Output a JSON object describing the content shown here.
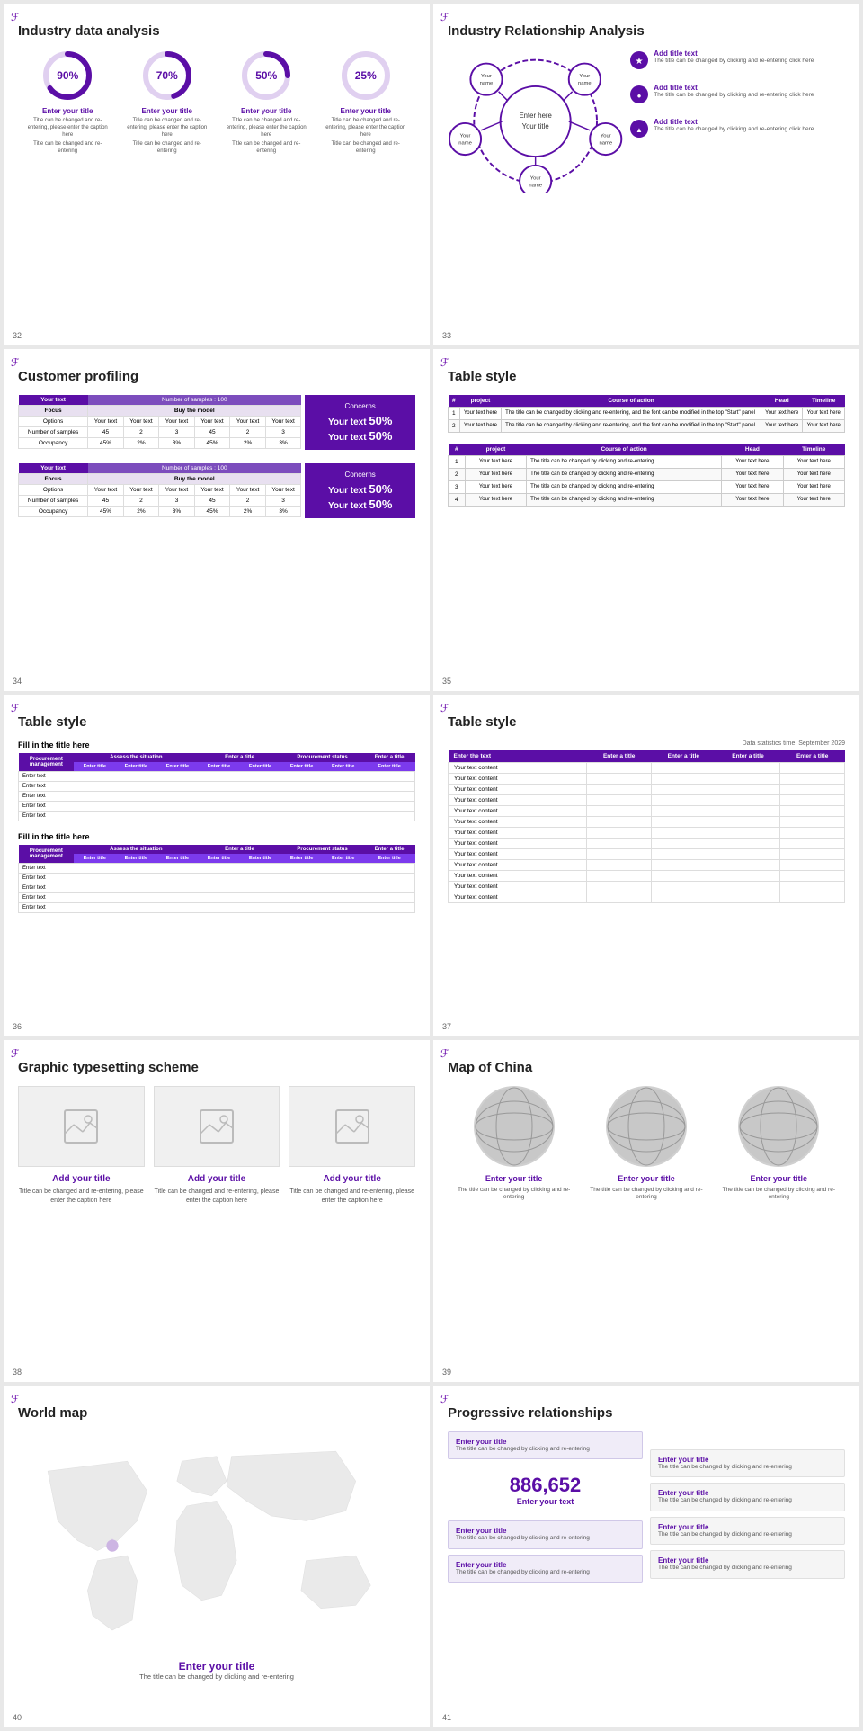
{
  "slides": {
    "s32": {
      "number": "32",
      "title": "Industry data analysis",
      "circles": [
        {
          "pct": "90%",
          "label": "Enter your title",
          "desc1": "Title can be changed and re-entering, please enter the caption here",
          "desc2": "Title can be changed and re-entering",
          "color": "#5b0ea6"
        },
        {
          "pct": "70%",
          "label": "Enter your title",
          "desc1": "Title can be changed and re-entering, please enter the caption here",
          "desc2": "Title can be changed and re-entering",
          "color": "#5b0ea6"
        },
        {
          "pct": "50%",
          "label": "Enter your title",
          "desc1": "Title can be changed and re-entering, please enter the caption here",
          "desc2": "Title can be changed and re-entering",
          "color": "#5b0ea6"
        },
        {
          "pct": "25%",
          "label": "Enter your title",
          "desc1": "Title can be changed and re-entering, please enter the caption here",
          "desc2": "Title can be changed and re-entering",
          "color": "#5b0ea6"
        }
      ]
    },
    "s33": {
      "number": "33",
      "title": "Industry Relationship Analysis",
      "hub": {
        "center_line1": "Enter here",
        "center_line2": "Your title",
        "nodes": [
          "Your name",
          "Your name",
          "Your name",
          "Your name",
          "Your name"
        ]
      },
      "right_items": [
        {
          "title": "Add title text",
          "desc": "The title can be changed by clicking and re-entering click here"
        },
        {
          "title": "Add title text",
          "desc": "The title can be changed by clicking and re-entering click here"
        },
        {
          "title": "Add title text",
          "desc": "The title can be changed by clicking and re-entering click here"
        }
      ]
    },
    "s34": {
      "number": "34",
      "title": "Customer profiling",
      "tables": [
        {
          "header": "Your text",
          "sample": "Number of samples : 100",
          "buy": "Buy the model",
          "rows": [
            {
              "label": "Focus",
              "cols": []
            },
            {
              "label": "Options",
              "cols": [
                "Your text",
                "Your text",
                "Your text",
                "Your text",
                "Your text",
                "Your text"
              ]
            },
            {
              "label": "Number of samples",
              "cols": [
                "45",
                "2",
                "3",
                "45",
                "2",
                "3"
              ]
            },
            {
              "label": "Occupancy",
              "cols": [
                "45%",
                "2%",
                "3%",
                "45%",
                "2%",
                "3%"
              ]
            }
          ],
          "concerns": {
            "pct1": "Your text 50%",
            "pct2": "Your text 50%"
          }
        },
        {
          "header": "Your text",
          "sample": "Number of samples : 100",
          "buy": "Buy the model",
          "rows": [
            {
              "label": "Focus",
              "cols": []
            },
            {
              "label": "Options",
              "cols": [
                "Your text",
                "Your text",
                "Your text",
                "Your text",
                "Your text",
                "Your text"
              ]
            },
            {
              "label": "Number of samples",
              "cols": [
                "45",
                "2",
                "3",
                "45",
                "2",
                "3"
              ]
            },
            {
              "label": "Occupancy",
              "cols": [
                "45%",
                "2%",
                "3%",
                "45%",
                "2%",
                "3%"
              ]
            }
          ],
          "concerns": {
            "pct1": "Your text 50%",
            "pct2": "Your text 50%"
          }
        }
      ]
    },
    "s35": {
      "number": "35",
      "title": "Table style",
      "headers": [
        "#",
        "project",
        "Course of action",
        "Head",
        "Timeline"
      ],
      "rows1": [
        [
          "1",
          "Your text here",
          "The title can be changed by clicking and re-entering, and the font can be modified in the top 'Start' panel",
          "Your text here",
          "Your text here"
        ],
        [
          "2",
          "Your text here",
          "The title can be changed by clicking and re-entering, and the font can be modified in the top 'Start' panel",
          "Your text here",
          "Your text here"
        ]
      ],
      "rows2": [
        [
          "1",
          "Your text here",
          "The title can be changed by clicking and re-entering",
          "Your text here",
          "Your text here"
        ],
        [
          "2",
          "Your text here",
          "The title can be changed by clicking and re-entering",
          "Your text here",
          "Your text here"
        ],
        [
          "3",
          "Your text here",
          "The title can be changed by clicking and re-entering",
          "Your text here",
          "Your text here"
        ],
        [
          "4",
          "Your text here",
          "The title can be changed by clicking and re-entering",
          "Your text here",
          "Your text here"
        ]
      ]
    },
    "s36": {
      "number": "36",
      "title": "Table style",
      "fill_title": "Fill in the title here",
      "table_headers": [
        "Procurement management",
        "Assess the situation",
        "",
        "Enter a title",
        "",
        "Procurement status",
        "Enter a title"
      ],
      "sub_headers": [
        "Enter title",
        "Enter title",
        "Enter title",
        "Enter title",
        "Enter title",
        "Enter title",
        "Enter title",
        "Enter title"
      ],
      "rows": [
        "Enter text",
        "Enter text",
        "Enter text",
        "Enter text",
        "Enter text"
      ]
    },
    "s37": {
      "number": "37",
      "title": "Table style",
      "data_time": "Data statistics time: September 2029",
      "headers": [
        "Enter the text",
        "Enter a title",
        "Enter a title",
        "Enter a title",
        "Enter a title"
      ],
      "rows": [
        "Your text content",
        "Your text content",
        "Your text content",
        "Your text content",
        "Your text content",
        "Your text content",
        "Your text content",
        "Your text content",
        "Your text content",
        "Your text content",
        "Your text content",
        "Your text content",
        "Your text content"
      ]
    },
    "s38": {
      "number": "38",
      "title": "Graphic typesetting scheme",
      "cards": [
        {
          "title": "Add your title",
          "desc": "Title can be changed and re-entering, please enter the caption here"
        },
        {
          "title": "Add your title",
          "desc": "Title can be changed and re-entering, please enter the caption here"
        },
        {
          "title": "Add your title",
          "desc": "Title can be changed and re-entering, please enter the caption here"
        }
      ]
    },
    "s39": {
      "number": "39",
      "title": "Map of China",
      "globes": [
        {
          "title": "Enter your title",
          "desc": "The title can be changed by clicking and re-entering"
        },
        {
          "title": "Enter your title",
          "desc": "The title can be changed by clicking and re-entering"
        },
        {
          "title": "Enter your title",
          "desc": "The title can be changed by clicking and re-entering"
        }
      ]
    },
    "s40": {
      "number": "40",
      "title": "World map",
      "map_title": "Enter your title",
      "map_desc": "The title can be changed by clicking and re-entering"
    },
    "s41": {
      "number": "41",
      "title": "Progressive relationships",
      "left_boxes": [
        {
          "title": "Enter your title",
          "desc": "The title can be changed by clicking and re-entering"
        },
        {
          "title": "Enter your title",
          "desc": "The title can be changed by clicking and re-entering"
        },
        {
          "title": "Enter your title",
          "desc": "The title can be changed by clicking and re-entering"
        }
      ],
      "center_number": "886,652",
      "center_text": "Enter your text",
      "right_boxes": [
        {
          "title": "Enter your title",
          "desc": "The title can be changed by clicking and re-entering"
        },
        {
          "title": "Enter your title",
          "desc": "The title can be changed by clicking and re-entering"
        },
        {
          "title": "Enter your title",
          "desc": "The title can be changed by clicking and re-entering"
        },
        {
          "title": "Enter your title",
          "desc": "The title can be changed by clicking and re-entering"
        }
      ]
    }
  },
  "icon": "ℱ",
  "accent": "#5b0ea6"
}
